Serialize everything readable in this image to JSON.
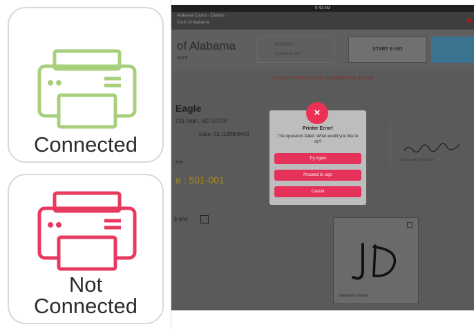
{
  "colors": {
    "connected": "#a8cf7c",
    "not_connected": "#e83a60",
    "dialog_button": "#e4325a"
  },
  "status_tiles": [
    {
      "label": "Connected",
      "icon": "printer-icon",
      "color": "#a8cf7c"
    },
    {
      "label": "Not\nConnected",
      "icon": "printer-icon",
      "color": "#e83a60"
    }
  ],
  "tablet": {
    "statusbar_time": "9:42 AM",
    "header_line1": "Alabama Courts · Citation",
    "header_line2": "Court of Alabama",
    "org_title": "of Alabama",
    "org_sub": "ount",
    "date_line1": "11/06/2017",
    "date_line2": "12:30 PM CST",
    "start_button": "START E-SIG",
    "warning": "CONFIDENTIAL PATIENT INFORMATION (HIPAA)",
    "person_name": "Eagle",
    "address": "231 Main, MD 20724",
    "dob": "Date: 01 /1989/0440",
    "small_label": "ase",
    "case_number": "e : 501-001",
    "checkbox_label": "s and",
    "sig_caption_a": "Defendant's Signature",
    "sig_caption_b": "Defendant's Initials"
  },
  "dialog": {
    "close_symbol": "×",
    "title": "Printer Error!",
    "message": "The operation failed. What would you like to do?",
    "buttons": [
      "Try Again",
      "Proceed to sign",
      "Cancel"
    ]
  }
}
